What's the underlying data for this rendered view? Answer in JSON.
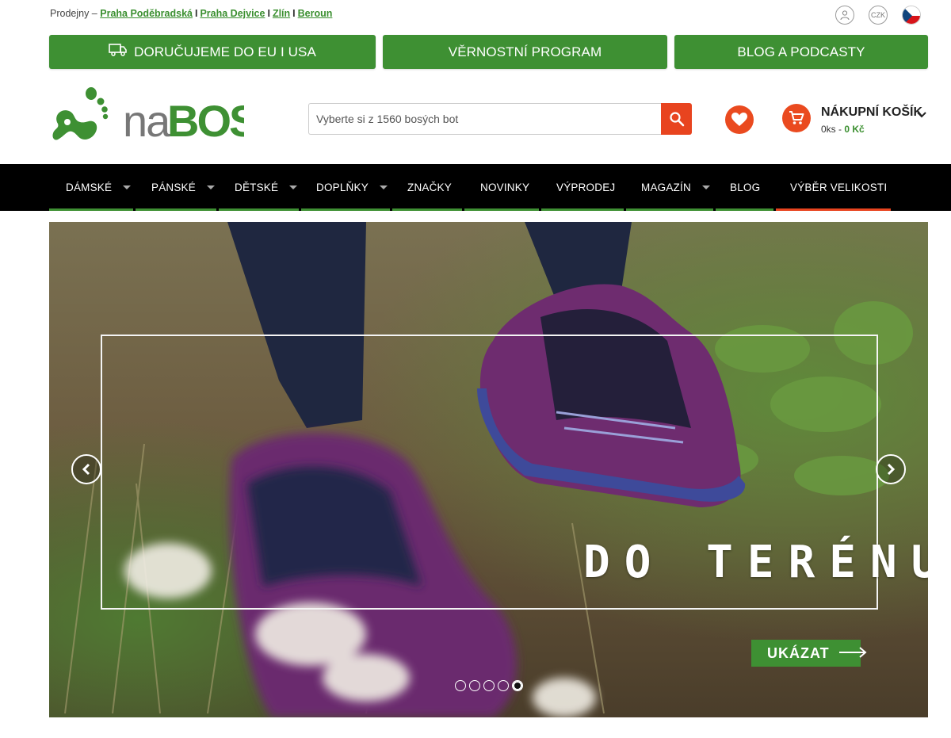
{
  "topbar": {
    "prefix": "Prodejny –",
    "stores": [
      "Praha Poděbradská",
      "Praha Dejvice",
      "Zlín",
      "Beroun"
    ],
    "separator": "I"
  },
  "top_icons": {
    "currency": "CZK",
    "user_icon": "user-icon",
    "flag_icon": "czech-flag-icon"
  },
  "promo": {
    "delivery": "DORUČUJEME DO EU I USA",
    "loyalty": "VĚRNOSTNÍ PROGRAM",
    "blog": "BLOG A PODCASTY"
  },
  "logo": {
    "text_light": "na",
    "text_bold": "BOSO"
  },
  "search": {
    "placeholder": "Vyberte si z 1560 bosých bot"
  },
  "cart": {
    "title": "NÁKUPNÍ KOŠÍK",
    "count": "0ks",
    "dash": " - ",
    "price": "0 Kč"
  },
  "nav": {
    "items": [
      {
        "label": "DÁMSKÉ",
        "has_dropdown": true
      },
      {
        "label": "PÁNSKÉ",
        "has_dropdown": true
      },
      {
        "label": "DĚTSKÉ",
        "has_dropdown": true
      },
      {
        "label": "DOPLŇKY",
        "has_dropdown": true
      },
      {
        "label": "ZNAČKY",
        "has_dropdown": false
      },
      {
        "label": "NOVINKY",
        "has_dropdown": false
      },
      {
        "label": "VÝPRODEJ",
        "has_dropdown": false
      },
      {
        "label": "MAGAZÍN",
        "has_dropdown": true
      },
      {
        "label": "BLOG",
        "has_dropdown": false
      },
      {
        "label": "VÝBĚR VELIKOSTI",
        "has_dropdown": false
      }
    ]
  },
  "hero": {
    "title": "DO TERÉNU",
    "cta": "UKÁZAT",
    "slide_count": 5,
    "active_slide": 5
  },
  "colors": {
    "brand_green": "#3e9033",
    "accent_orange": "#e8441f",
    "nav_bg": "#000000"
  }
}
